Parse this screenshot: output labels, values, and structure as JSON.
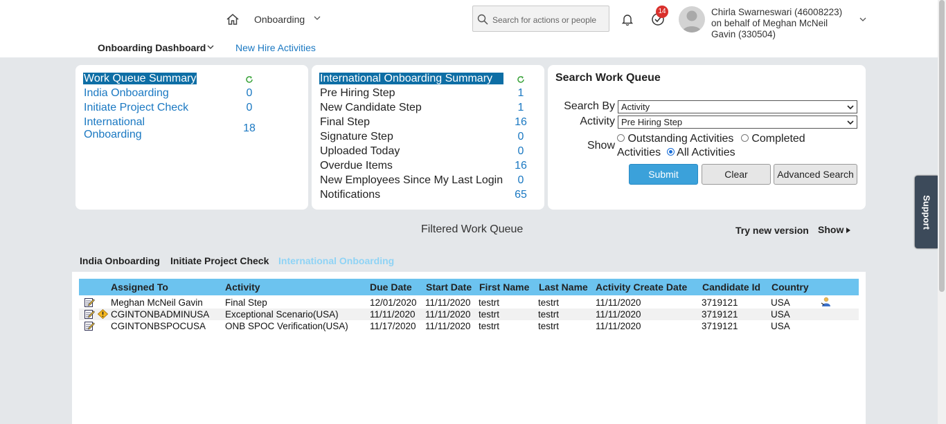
{
  "header": {
    "module": "Onboarding",
    "search_placeholder": "Search for actions or people",
    "todo_count": "14",
    "user_line1": "Chirla Swarneswari (46008223)",
    "user_line2": "on behalf of Meghan McNeil",
    "user_line3": "Gavin (330504)"
  },
  "subnav": {
    "dashboard": "Onboarding Dashboard",
    "new_hire": "New Hire Activities"
  },
  "support_label": "Support",
  "work_queue_summary": {
    "title": "Work Queue Summary",
    "items": [
      {
        "label": "India Onboarding",
        "count": "0"
      },
      {
        "label": "Initiate Project Check",
        "count": "0"
      },
      {
        "label_line1": "International",
        "label_line2": "Onboarding",
        "count": "18"
      }
    ]
  },
  "international_summary": {
    "title": "International Onboarding Summary",
    "items": [
      {
        "label": "Pre Hiring Step",
        "count": "1"
      },
      {
        "label": "New Candidate Step",
        "count": "1"
      },
      {
        "label": "Final Step",
        "count": "16"
      },
      {
        "label": "Signature Step",
        "count": "0"
      },
      {
        "label": "Uploaded Today",
        "count": "0"
      },
      {
        "label": "Overdue Items",
        "count": "16"
      },
      {
        "label": "New Employees Since My Last Login",
        "count": "0"
      },
      {
        "label": "Notifications",
        "count": "65"
      }
    ]
  },
  "search_work_queue": {
    "title": "Search Work Queue",
    "search_by_label": "Search By",
    "search_by_value": "Activity",
    "activity_label": "Activity",
    "activity_value": "Pre Hiring Step",
    "show_label": "Show",
    "option_outstanding": "Outstanding Activities",
    "option_completed_1": "Completed",
    "option_completed_2": "Activities",
    "option_all": "All Activities",
    "submit": "Submit",
    "clear": "Clear",
    "advanced": "Advanced Search"
  },
  "filtered": {
    "title": "Filtered Work Queue",
    "try_new": "Try new version",
    "show": "Show",
    "tabs": [
      "India Onboarding",
      "Initiate Project Check",
      "International Onboarding"
    ],
    "active_tab": "International Onboarding"
  },
  "table": {
    "columns": [
      "Assigned To",
      "Activity",
      "Due Date",
      "Start Date",
      "First Name",
      "Last Name",
      "Activity Create Date",
      "Candidate Id",
      "Country"
    ],
    "rows": [
      {
        "assigned": "Meghan McNeil Gavin",
        "activity": "Final Step",
        "due": "12/01/2020",
        "start": "11/11/2020",
        "first": "testrt",
        "last": "testrt",
        "created": "11/11/2020",
        "candidate": "3719121",
        "country": "USA"
      },
      {
        "assigned": "CGINTONBADMINUSA",
        "activity": "Exceptional Scenario(USA)",
        "due": "11/11/2020",
        "start": "11/11/2020",
        "first": "testrt",
        "last": "testrt",
        "created": "11/11/2020",
        "candidate": "3719121",
        "country": "USA"
      },
      {
        "assigned": "CGINTONBSPOCUSA",
        "activity": "ONB SPOC Verification(USA)",
        "due": "11/17/2020",
        "start": "11/11/2020",
        "first": "testrt",
        "last": "testrt",
        "created": "11/11/2020",
        "candidate": "3719121",
        "country": "USA"
      }
    ]
  },
  "icons": {
    "home": "home-icon",
    "bell": "bell-icon",
    "todo": "todo-check-icon",
    "refresh": "refresh-icon",
    "edit": "edit-icon",
    "warning": "warning-icon",
    "person": "person-icon"
  },
  "colors": {
    "summary_header": "#0e6ea5",
    "link": "#1a78c2",
    "table_header": "#6cc3ef",
    "active_tab": "#8fd3f5",
    "submit": "#3ba1da",
    "badge": "#d9302c"
  }
}
